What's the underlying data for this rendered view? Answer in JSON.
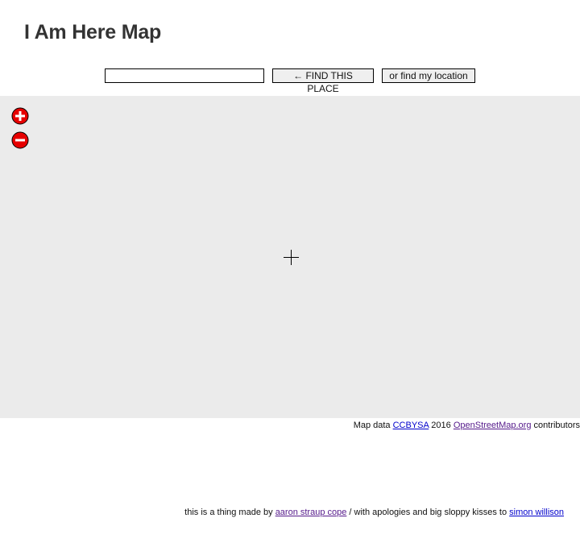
{
  "header": {
    "title": "I Am Here Map"
  },
  "search": {
    "value": "",
    "placeholder": "",
    "find_button": "← FIND THIS PLACE",
    "locate_button": "or find my location"
  },
  "map": {
    "zoom_in_icon": "plus-circle-icon",
    "zoom_out_icon": "minus-circle-icon",
    "crosshair_icon": "crosshair-icon",
    "background_color": "#ebebeb",
    "zoom_button_color": "#e60000"
  },
  "attribution": {
    "prefix": "Map data ",
    "license_link": "CCBYSA",
    "year": " 2016 ",
    "osm_link": "OpenStreetMap.org",
    "suffix": " contributors"
  },
  "footer": {
    "prefix": "this is a thing made by ",
    "author_link": "aaron straup cope",
    "middle": " / with apologies and big sloppy kisses to ",
    "credit_link": "simon willison"
  }
}
